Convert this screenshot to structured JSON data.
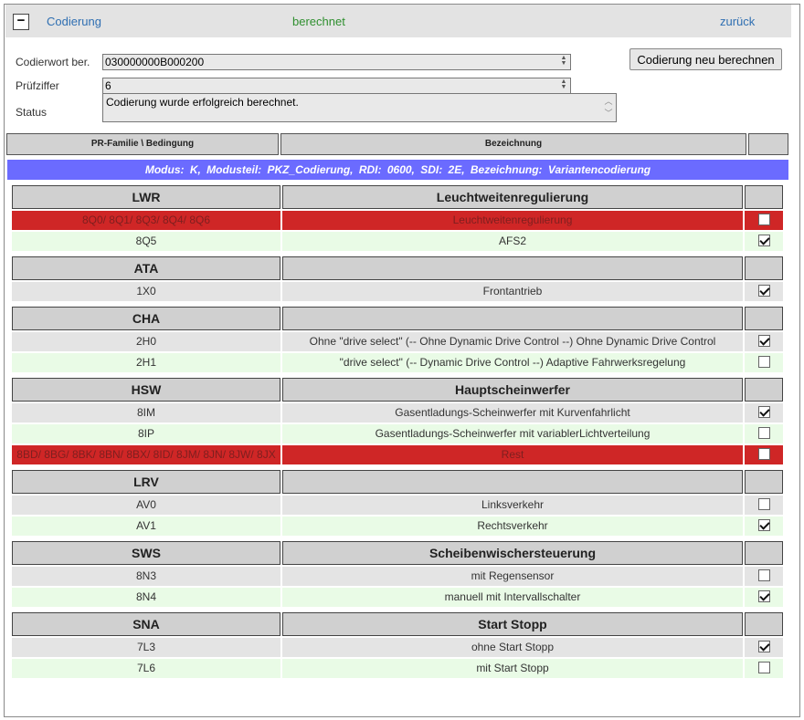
{
  "header": {
    "collapse_label": "−",
    "title": "Codierung",
    "state": "berechnet",
    "back": "zurück"
  },
  "form": {
    "codierwort_label": "Codierwort ber.",
    "codierwort_value": "030000000B000200",
    "pruefziffer_label": "Prüfziffer",
    "pruefziffer_value": "6",
    "status_label": "Status",
    "status_value": "Codierung wurde erfolgreich berechnet.",
    "recalc_button": "Codierung neu berechnen"
  },
  "columns": {
    "pr": "PR-Familie \\ Bedingung",
    "bez": "Bezeichnung",
    "chk": ""
  },
  "modus_line": "Modus:  K,  Modusteil:  PKZ_Codierung,  RDI:  0600,  SDI:  2E,  Bezeichnung:  Variantencodierung",
  "groups": [
    {
      "family": "LWR",
      "title": "Leuchtweitenregulierung",
      "rows": [
        {
          "code": "8Q0/ 8Q1/ 8Q3/ 8Q4/ 8Q6",
          "desc": "Leuchtweitenregulierung",
          "checked": false,
          "color": "red"
        },
        {
          "code": "8Q5",
          "desc": "AFS2",
          "checked": true,
          "color": "green"
        }
      ]
    },
    {
      "family": "ATA",
      "title": "",
      "rows": [
        {
          "code": "1X0",
          "desc": "Frontantrieb",
          "checked": true,
          "color": "gray"
        }
      ]
    },
    {
      "family": "CHA",
      "title": "",
      "rows": [
        {
          "code": "2H0",
          "desc": "Ohne \"drive select\" (-- Ohne Dynamic Drive Control --) Ohne Dynamic Drive Control",
          "checked": true,
          "color": "gray"
        },
        {
          "code": "2H1",
          "desc": "\"drive select\" (-- Dynamic Drive Control --) Adaptive Fahrwerksregelung",
          "checked": false,
          "color": "green"
        }
      ]
    },
    {
      "family": "HSW",
      "title": "Hauptscheinwerfer",
      "rows": [
        {
          "code": "8IM",
          "desc": "Gasentladungs-Scheinwerfer mit Kurvenfahrlicht",
          "checked": true,
          "color": "gray"
        },
        {
          "code": "8IP",
          "desc": "Gasentladungs-Scheinwerfer mit variablerLichtverteilung",
          "checked": false,
          "color": "green"
        },
        {
          "code": "8BD/ 8BG/ 8BK/ 8BN/ 8BX/ 8ID/ 8JM/ 8JN/ 8JW/ 8JX",
          "desc": "Rest",
          "checked": false,
          "color": "red"
        }
      ]
    },
    {
      "family": "LRV",
      "title": "",
      "rows": [
        {
          "code": "AV0",
          "desc": "Linksverkehr",
          "checked": false,
          "color": "gray"
        },
        {
          "code": "AV1",
          "desc": "Rechtsverkehr",
          "checked": true,
          "color": "green"
        }
      ]
    },
    {
      "family": "SWS",
      "title": "Scheibenwischersteuerung",
      "rows": [
        {
          "code": "8N3",
          "desc": "mit Regensensor",
          "checked": false,
          "color": "gray"
        },
        {
          "code": "8N4",
          "desc": "manuell mit Intervallschalter",
          "checked": true,
          "color": "green"
        }
      ]
    },
    {
      "family": "SNA",
      "title": "Start Stopp",
      "rows": [
        {
          "code": "7L3",
          "desc": "ohne Start Stopp",
          "checked": true,
          "color": "gray"
        },
        {
          "code": "7L6",
          "desc": "mit Start Stopp",
          "checked": false,
          "color": "green"
        }
      ]
    }
  ]
}
